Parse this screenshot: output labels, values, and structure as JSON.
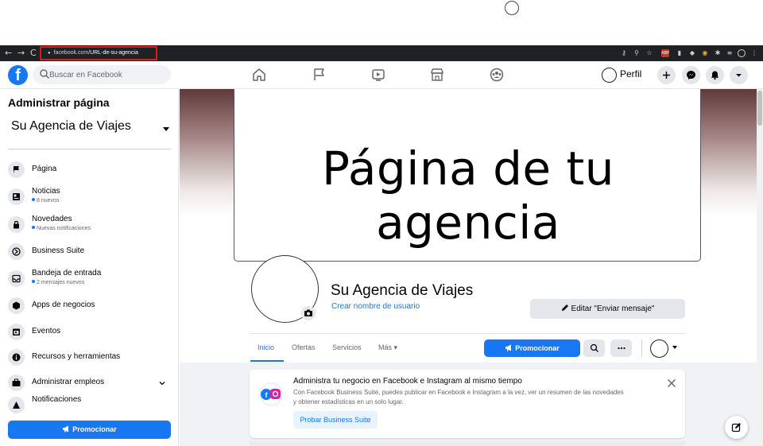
{
  "browser": {
    "url_domain": "facebook.com/",
    "url_path": "URL-de-su-agencia",
    "back_glyph": "←",
    "forward_glyph": "→",
    "reload_glyph": "C",
    "menu_glyph": "⋮"
  },
  "topnav": {
    "logo": "f",
    "search_placeholder": "Buscar en Facebook",
    "profile_label": "Perfil",
    "tabs": [
      "home-icon",
      "flag-icon",
      "video-icon",
      "marketplace-icon",
      "groups-icon"
    ],
    "actions": [
      "plus-icon",
      "messenger-icon",
      "bell-icon",
      "caret-down-icon"
    ]
  },
  "sidebar": {
    "title": "Administrar página",
    "page_name": "Su Agencia de Viajes",
    "items": [
      {
        "label": "Página",
        "sub": "",
        "icon": "flag-icon"
      },
      {
        "label": "Noticias",
        "sub": "8 nuevos",
        "icon": "news-icon"
      },
      {
        "label": "Novedades",
        "sub": "Nuevas notificaciones",
        "icon": "lock-icon"
      },
      {
        "label": "Business Suite",
        "sub": "",
        "icon": "business-suite-icon"
      },
      {
        "label": "Bandeja de entrada",
        "sub": "2 mensajes nuevos",
        "icon": "inbox-icon"
      },
      {
        "label": "Apps de negocios",
        "sub": "",
        "icon": "cube-icon"
      },
      {
        "label": "Eventos",
        "sub": "",
        "icon": "calendar-icon"
      },
      {
        "label": "Recursos y herramientas",
        "sub": "",
        "icon": "info-icon"
      },
      {
        "label": "Administrar empleos",
        "sub": "",
        "icon": "briefcase-icon"
      },
      {
        "label": "Notificaciones",
        "sub": "",
        "icon": "notification-icon"
      }
    ],
    "promote_label": "Promocionar"
  },
  "page": {
    "cover_text": "Página de tu agencia",
    "name": "Su Agencia de Viajes",
    "username_link": "Crear nombre de usuario",
    "edit_button": "Editar \"Enviar mensaje\"",
    "tabs": [
      {
        "label": "Inicio",
        "active": true
      },
      {
        "label": "Ofertas",
        "active": false
      },
      {
        "label": "Servicios",
        "active": false
      },
      {
        "label": "Más",
        "active": false
      }
    ],
    "promote_label": "Promocionar"
  },
  "business_suite_card": {
    "title": "Administra tu negocio en Facebook e Instagram al mismo tiempo",
    "description": "Con Facebook Business Suite, puedes publicar en Facebook e Instagram a la vez, ver un resumen de las novedades y obtener estadísticas en un solo lugar.",
    "button": "Probar Business Suite"
  },
  "colors": {
    "accent": "#1877f2",
    "highlight_border": "#e0191b",
    "browser_bar": "#202124"
  }
}
